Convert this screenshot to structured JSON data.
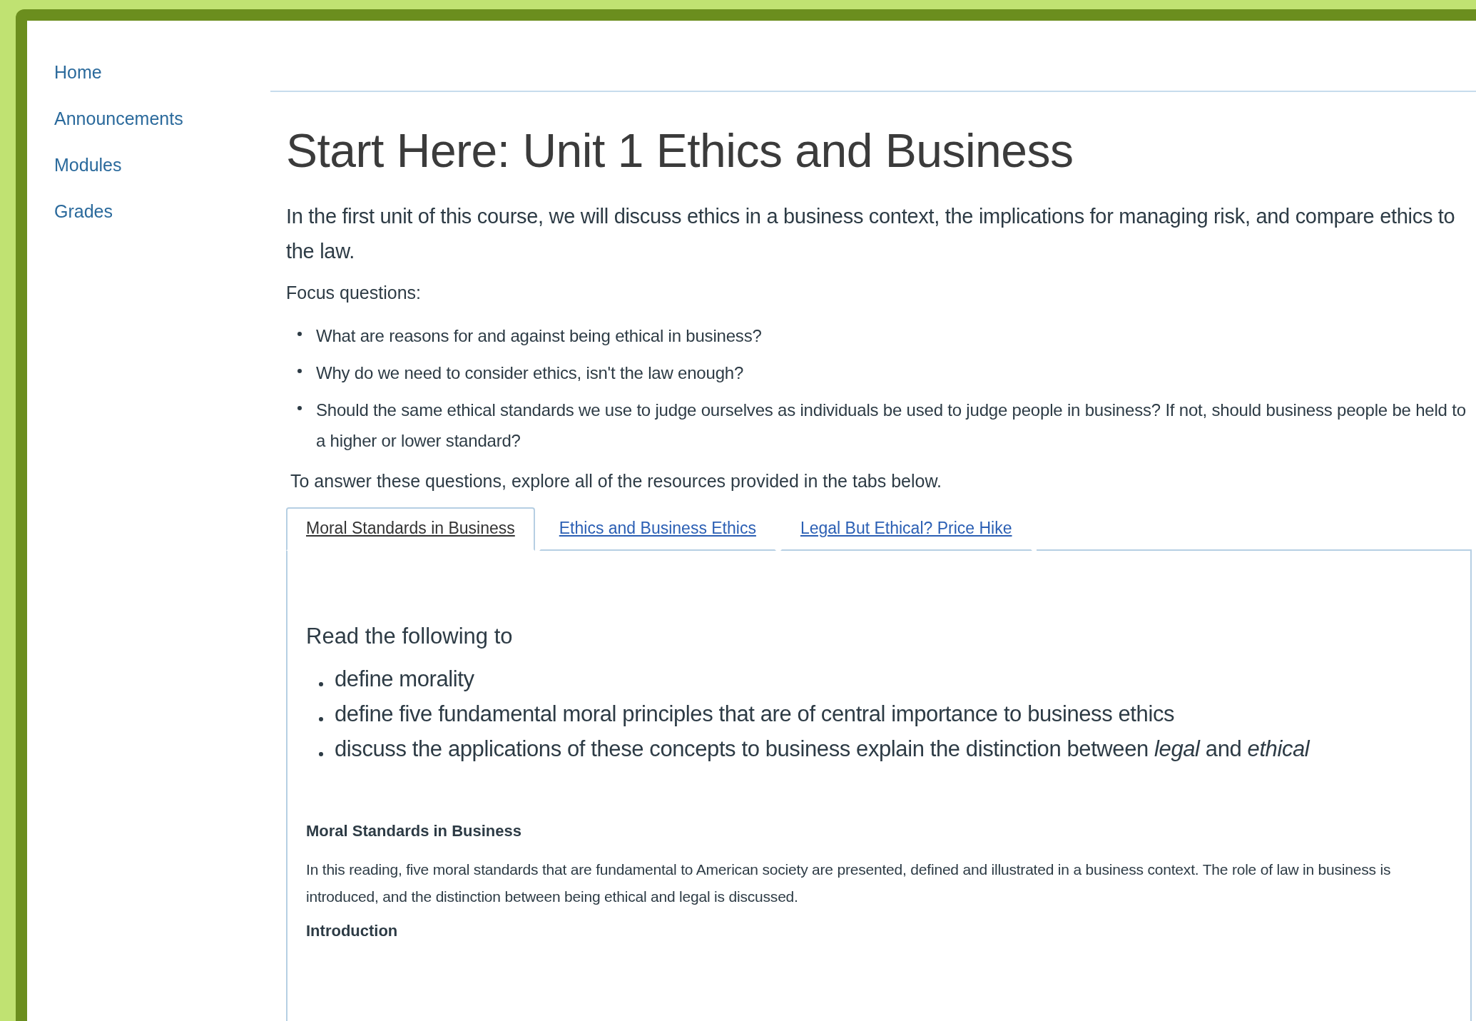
{
  "course_nav": {
    "items": [
      {
        "label": "Home"
      },
      {
        "label": "Announcements"
      },
      {
        "label": "Modules"
      },
      {
        "label": "Grades"
      }
    ]
  },
  "page": {
    "title": "Start Here: Unit 1 Ethics and Business",
    "intro": "In the first unit of this course, we will discuss ethics in a business context, the implications for managing risk, and compare ethics to the law.",
    "focus_label": "Focus questions:",
    "focus_questions": [
      "What are reasons for and against being ethical in business?",
      "Why do we need to consider ethics, isn't the law enough?",
      "Should the same ethical standards we use to judge ourselves as individuals be used to judge people in business? If not, should business people be held to a higher or lower standard?"
    ],
    "instruction": "To answer these questions, explore all of the resources provided in the tabs below.",
    "tabs": [
      {
        "label": "Moral Standards in Business",
        "selected": true
      },
      {
        "label": "Ethics and Business Ethics",
        "selected": false
      },
      {
        "label": "Legal But Ethical? Price Hike",
        "selected": false
      }
    ],
    "tab_panel": {
      "lead": "Read the following to",
      "objectives": [
        "define morality",
        "define five fundamental moral principles that are of central importance to business ethics",
        "discuss the applications of these concepts to business explain the distinction between *legal* and *ethical*"
      ],
      "sections": [
        {
          "kind": "heading",
          "text": "Moral Standards in Business"
        },
        {
          "kind": "paragraph",
          "text": "In this reading, five moral standards that are fundamental to American society are presented, defined and illustrated in a business context. The role of law in business is introduced, and the distinction between being ethical and legal is discussed."
        },
        {
          "kind": "heading",
          "text": "Introduction"
        }
      ]
    }
  }
}
